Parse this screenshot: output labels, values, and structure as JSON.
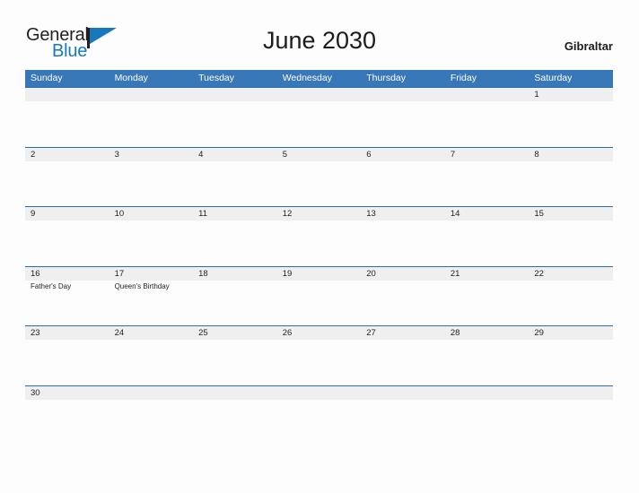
{
  "brand": {
    "word_one": "General",
    "word_two": "Blue",
    "flag_icon": "flag-icon",
    "accent_color": "#1878be",
    "dark_color": "#231f20"
  },
  "header": {
    "title": "June 2030",
    "region": "Gibraltar"
  },
  "theme": {
    "header_blue": "#3878b8",
    "divider_blue": "#2e6da4",
    "daynum_band_gray": "#efefef",
    "page_background": "#fdfdfd",
    "text_color": "#1f1f1f"
  },
  "calendar": {
    "month": "June",
    "year": "2030",
    "weekday_headers": [
      "Sunday",
      "Monday",
      "Tuesday",
      "Wednesday",
      "Thursday",
      "Friday",
      "Saturday"
    ],
    "weeks": [
      [
        {
          "date": "",
          "event": ""
        },
        {
          "date": "",
          "event": ""
        },
        {
          "date": "",
          "event": ""
        },
        {
          "date": "",
          "event": ""
        },
        {
          "date": "",
          "event": ""
        },
        {
          "date": "",
          "event": ""
        },
        {
          "date": "1",
          "event": ""
        }
      ],
      [
        {
          "date": "2",
          "event": ""
        },
        {
          "date": "3",
          "event": ""
        },
        {
          "date": "4",
          "event": ""
        },
        {
          "date": "5",
          "event": ""
        },
        {
          "date": "6",
          "event": ""
        },
        {
          "date": "7",
          "event": ""
        },
        {
          "date": "8",
          "event": ""
        }
      ],
      [
        {
          "date": "9",
          "event": ""
        },
        {
          "date": "10",
          "event": ""
        },
        {
          "date": "11",
          "event": ""
        },
        {
          "date": "12",
          "event": ""
        },
        {
          "date": "13",
          "event": ""
        },
        {
          "date": "14",
          "event": ""
        },
        {
          "date": "15",
          "event": ""
        }
      ],
      [
        {
          "date": "16",
          "event": "Father's Day"
        },
        {
          "date": "17",
          "event": "Queen's Birthday"
        },
        {
          "date": "18",
          "event": ""
        },
        {
          "date": "19",
          "event": ""
        },
        {
          "date": "20",
          "event": ""
        },
        {
          "date": "21",
          "event": ""
        },
        {
          "date": "22",
          "event": ""
        }
      ],
      [
        {
          "date": "23",
          "event": ""
        },
        {
          "date": "24",
          "event": ""
        },
        {
          "date": "25",
          "event": ""
        },
        {
          "date": "26",
          "event": ""
        },
        {
          "date": "27",
          "event": ""
        },
        {
          "date": "28",
          "event": ""
        },
        {
          "date": "29",
          "event": ""
        }
      ],
      [
        {
          "date": "30",
          "event": ""
        },
        {
          "date": "",
          "event": ""
        },
        {
          "date": "",
          "event": ""
        },
        {
          "date": "",
          "event": ""
        },
        {
          "date": "",
          "event": ""
        },
        {
          "date": "",
          "event": ""
        },
        {
          "date": "",
          "event": ""
        }
      ]
    ]
  }
}
